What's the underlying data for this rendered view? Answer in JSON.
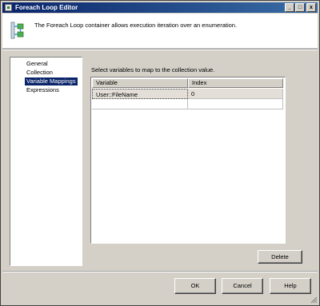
{
  "window": {
    "title": "Foreach Loop Editor",
    "minimize_label": "_",
    "maximize_label": "□",
    "close_label": "x"
  },
  "header": {
    "description": "The Foreach Loop container allows execution iteration over an enumeration."
  },
  "nav": {
    "items": [
      {
        "label": "General"
      },
      {
        "label": "Collection"
      },
      {
        "label": "Variable Mappings"
      },
      {
        "label": "Expressions"
      }
    ],
    "selected": "Variable Mappings"
  },
  "main": {
    "instruction": "Select variables to map to the collection value.",
    "grid": {
      "columns": [
        "Variable",
        "Index"
      ],
      "rows": [
        {
          "variable": "User::FileName",
          "index": "0"
        },
        {
          "variable": "",
          "index": ""
        }
      ]
    },
    "delete_label": "Delete"
  },
  "footer": {
    "ok_label": "OK",
    "cancel_label": "Cancel",
    "help_label": "Help"
  },
  "colors": {
    "titlebar": "#0a246a",
    "dialog_bg": "#d4d0c8",
    "selection": "#0a246a"
  }
}
